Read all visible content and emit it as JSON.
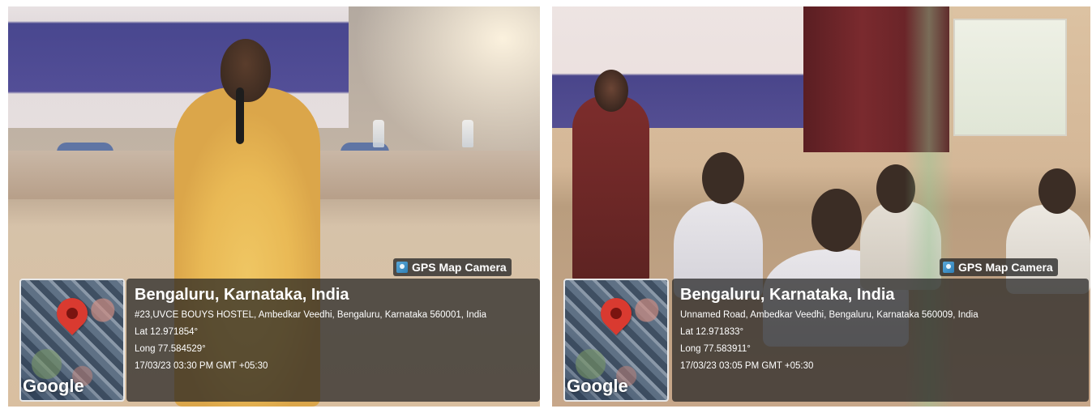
{
  "photos": [
    {
      "overlay": {
        "camera_label": "GPS Map Camera",
        "location": "Bengaluru, Karnataka, India",
        "address": "#23,UVCE BOUYS HOSTEL, Ambedkar Veedhi, Bengaluru, Karnataka 560001, India",
        "lat": "Lat 12.971854°",
        "long": "Long 77.584529°",
        "datetime": "17/03/23 03:30 PM GMT +05:30",
        "map_logo": "Google"
      }
    },
    {
      "overlay": {
        "camera_label": "GPS Map Camera",
        "location": "Bengaluru, Karnataka, India",
        "address": "Unnamed Road, Ambedkar Veedhi, Bengaluru, Karnataka 560009, India",
        "lat": "Lat 12.971833°",
        "long": "Long 77.583911°",
        "datetime": "17/03/23 03:05 PM GMT +05:30",
        "map_logo": "Google"
      }
    }
  ],
  "icons": {
    "camera_badge": "gps-map-camera-icon",
    "map_marker": "map-pin-icon"
  },
  "colors": {
    "pin": "#d93a30",
    "overlay_bg": "#232323",
    "camera_icon": "#2e7fb6"
  }
}
